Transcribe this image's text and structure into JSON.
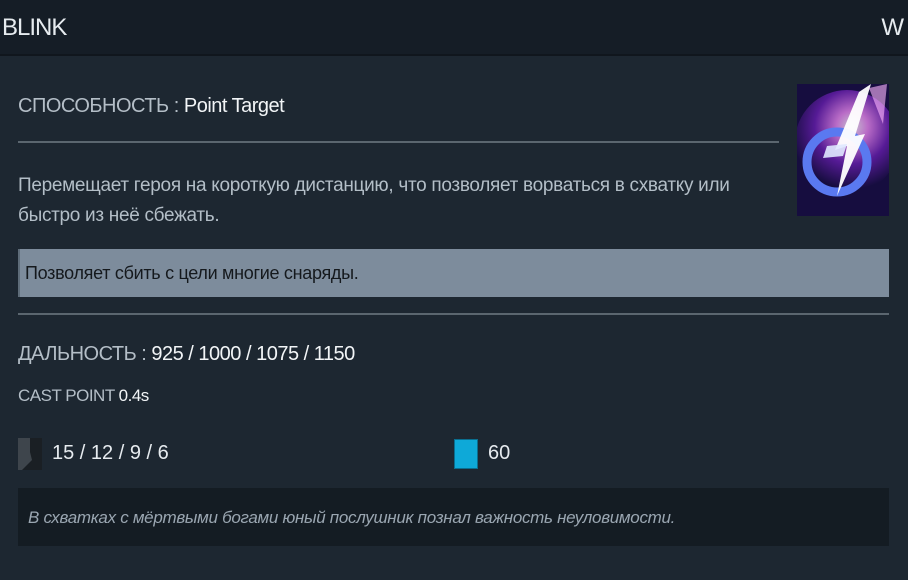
{
  "ability": {
    "name": "BLINK",
    "hotkey": "W",
    "type_label": "СПОСОБНОСТЬ :",
    "type_value": "Point Target",
    "description": "Перемещает героя на короткую дистанцию, что позволяет ворваться в схватку или быстро из неё сбежать.",
    "note": "Позволяет сбить с цели многие снаряды.",
    "icon": "blink-ability-icon"
  },
  "stats": {
    "range_label": "ДАЛЬНОСТЬ :",
    "range_value": "925 / 1000 / 1075 / 1150",
    "cast_point_label": "CAST POINT",
    "cast_point_value": "0.4s"
  },
  "costs": {
    "cooldown_icon": "cooldown-icon",
    "cooldown": "15 / 12 / 9 / 6",
    "mana_icon": "mana-icon",
    "mana": "60",
    "mana_color": "#0ea9d8"
  },
  "lore": "В схватках с мёртвыми богами юный послушник познал важность неуловимости."
}
